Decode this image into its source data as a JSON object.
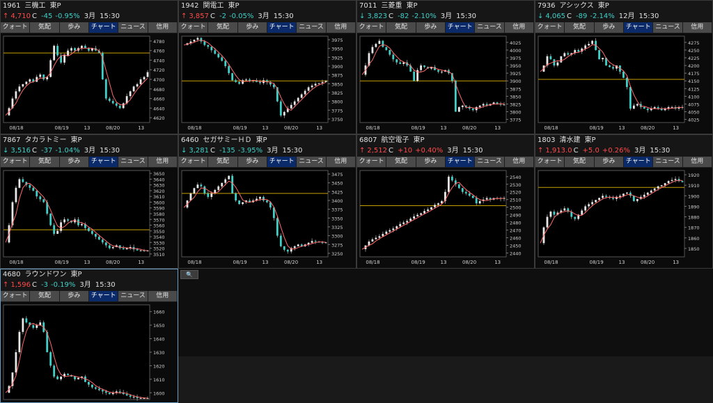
{
  "tabs": [
    "クォート",
    "気配",
    "歩み",
    "チャート",
    "ニュース",
    "信用"
  ],
  "active_tab": "チャート",
  "colors": {
    "up": "#ff4a4a",
    "down": "#3fd0c8",
    "candle_up": "#e8e8e8",
    "candle_down": "#3fd0c8",
    "ma": "#ff6b6b",
    "ref": "#c8a000",
    "axis": "#cfcfcf"
  },
  "search_icon": "magnifier-icon",
  "panels": [
    {
      "code": "1961",
      "name": "三機工",
      "market": "東P",
      "direction": "up",
      "price": "4,710",
      "unit": "C",
      "change": "-45",
      "pct": "-0.95%",
      "month": "3月",
      "time": "15:30",
      "x_labels": [
        "08/18",
        "08/19",
        "13",
        "08/20",
        "13"
      ],
      "y_labels": [
        "4780",
        "4760",
        "4740",
        "4720",
        "4700",
        "4680",
        "4660",
        "4640",
        "4620"
      ],
      "y_range": [
        4610,
        4790
      ],
      "ref": 4755,
      "chart_data": {
        "type": "candlestick",
        "series": [
          {
            "values": [
              4625,
              4640,
              4660,
              4675,
              4685,
              4690,
              4695,
              4700,
              4695,
              4705,
              4710,
              4700,
              4705,
              4740,
              4770,
              4750,
              4735,
              4750,
              4760,
              4765,
              4760,
              4765,
              4770,
              4765,
              4760,
              4765,
              4760,
              4755,
              4700,
              4660,
              4655,
              4650,
              4645,
              4640,
              4650,
              4665,
              4675,
              4685,
              4690,
              4700,
              4705,
              4715
            ]
          }
        ]
      }
    },
    {
      "code": "1942",
      "name": "関電工",
      "market": "東P",
      "direction": "up",
      "price": "3,857",
      "unit": "C",
      "change": "-2",
      "pct": "-0.05%",
      "month": "3月",
      "time": "15:30",
      "x_labels": [
        "08/18",
        "08/19",
        "13",
        "08/20",
        "13"
      ],
      "y_labels": [
        "3975",
        "3950",
        "3925",
        "3900",
        "3875",
        "3850",
        "3825",
        "3800",
        "3775",
        "3750"
      ],
      "y_range": [
        3740,
        3985
      ],
      "ref": 3858,
      "chart_data": {
        "type": "candlestick",
        "series": [
          {
            "values": [
              3960,
              3965,
              3970,
              3975,
              3980,
              3970,
              3960,
              3955,
              3945,
              3935,
              3925,
              3915,
              3900,
              3880,
              3860,
              3855,
              3850,
              3860,
              3862,
              3858,
              3860,
              3855,
              3852,
              3860,
              3855,
              3848,
              3840,
              3800,
              3760,
              3770,
              3780,
              3790,
              3800,
              3810,
              3820,
              3830,
              3840,
              3845,
              3850,
              3852,
              3855,
              3858
            ]
          }
        ]
      }
    },
    {
      "code": "7011",
      "name": "三菱重",
      "market": "東P",
      "direction": "down",
      "price": "3,823",
      "unit": "C",
      "change": "-82",
      "pct": "-2.10%",
      "month": "3月",
      "time": "15:30",
      "x_labels": [
        "08/18",
        "08/19",
        "13",
        "08/20",
        "13"
      ],
      "y_labels": [
        "4025",
        "4000",
        "3975",
        "3950",
        "3925",
        "3900",
        "3875",
        "3850",
        "3825",
        "3800",
        "3775"
      ],
      "y_range": [
        3765,
        4045
      ],
      "ref": 3900,
      "chart_data": {
        "type": "candlestick",
        "series": [
          {
            "values": [
              3920,
              3950,
              3990,
              4010,
              4020,
              4030,
              4010,
              4000,
              3985,
              3970,
              3960,
              3955,
              3960,
              3950,
              3930,
              3900,
              3935,
              3950,
              3945,
              3940,
              3945,
              3935,
              3930,
              3930,
              3935,
              3925,
              3900,
              3800,
              3815,
              3820,
              3815,
              3810,
              3805,
              3815,
              3820,
              3825,
              3820,
              3825,
              3830,
              3825,
              3823,
              3823
            ]
          }
        ]
      }
    },
    {
      "code": "7936",
      "name": "アシックス",
      "market": "東P",
      "direction": "down",
      "price": "4,065",
      "unit": "C",
      "change": "-89",
      "pct": "-2.14%",
      "month": "12月",
      "time": "15:30",
      "x_labels": [
        "08/18",
        "08/19",
        "13",
        "08/20",
        "13"
      ],
      "y_labels": [
        "4275",
        "4250",
        "4225",
        "4200",
        "4175",
        "4150",
        "4125",
        "4100",
        "4075",
        "4050",
        "4025"
      ],
      "y_range": [
        4015,
        4295
      ],
      "ref": 4155,
      "chart_data": {
        "type": "candlestick",
        "series": [
          {
            "values": [
              4180,
              4200,
              4230,
              4220,
              4200,
              4210,
              4230,
              4240,
              4235,
              4240,
              4250,
              4245,
              4255,
              4265,
              4270,
              4280,
              4250,
              4220,
              4225,
              4200,
              4195,
              4190,
              4200,
              4180,
              4160,
              4130,
              4060,
              4070,
              4075,
              4065,
              4060,
              4055,
              4060,
              4065,
              4060,
              4055,
              4060,
              4065,
              4065,
              4060,
              4065,
              4065
            ]
          }
        ]
      }
    },
    {
      "code": "7867",
      "name": "タカラトミー",
      "market": "東P",
      "direction": "down",
      "price": "3,516",
      "unit": "C",
      "change": "-37",
      "pct": "-1.04%",
      "month": "3月",
      "time": "15:30",
      "x_labels": [
        "08/18",
        "08/19",
        "13",
        "08/20",
        "13"
      ],
      "y_labels": [
        "3650",
        "3640",
        "3630",
        "3620",
        "3610",
        "3600",
        "3590",
        "3580",
        "3570",
        "3560",
        "3550",
        "3540",
        "3530",
        "3520",
        "3510"
      ],
      "y_range": [
        3505,
        3655
      ],
      "ref": 3552,
      "chart_data": {
        "type": "candlestick",
        "series": [
          {
            "values": [
              3530,
              3560,
              3600,
              3625,
              3640,
              3635,
              3630,
              3625,
              3620,
              3610,
              3605,
              3600,
              3580,
              3560,
              3545,
              3550,
              3565,
              3570,
              3568,
              3565,
              3570,
              3560,
              3562,
              3555,
              3550,
              3545,
              3540,
              3535,
              3530,
              3525,
              3520,
              3522,
              3525,
              3520,
              3518,
              3520,
              3522,
              3518,
              3516,
              3516,
              3515,
              3516
            ]
          }
        ]
      }
    },
    {
      "code": "6460",
      "name": "セガサミーＨＤ",
      "market": "東P",
      "direction": "down",
      "price": "3,281",
      "unit": "C",
      "change": "-135",
      "pct": "-3.95%",
      "month": "3月",
      "time": "15:30",
      "x_labels": [
        "08/18",
        "08/19",
        "13",
        "08/20",
        "13"
      ],
      "y_labels": [
        "3475",
        "3450",
        "3425",
        "3400",
        "3375",
        "3350",
        "3325",
        "3300",
        "3275",
        "3250"
      ],
      "y_range": [
        3240,
        3485
      ],
      "ref": 3420,
      "chart_data": {
        "type": "candlestick",
        "series": [
          {
            "values": [
              3380,
              3400,
              3420,
              3435,
              3445,
              3440,
              3420,
              3410,
              3420,
              3430,
              3440,
              3450,
              3460,
              3470,
              3420,
              3400,
              3390,
              3395,
              3400,
              3395,
              3400,
              3405,
              3410,
              3400,
              3395,
              3380,
              3350,
              3300,
              3270,
              3260,
              3255,
              3265,
              3270,
              3275,
              3270,
              3275,
              3280,
              3285,
              3283,
              3281,
              3280,
              3281
            ]
          }
        ]
      }
    },
    {
      "code": "6807",
      "name": "航空電子",
      "market": "東P",
      "direction": "up",
      "price": "2,512",
      "unit": "C",
      "change": "+10",
      "pct": "+0.40%",
      "month": "3月",
      "time": "15:30",
      "x_labels": [
        "08/18",
        "08/19",
        "13",
        "08/20",
        "13"
      ],
      "y_labels": [
        "2540",
        "2530",
        "2520",
        "2510",
        "2500",
        "2490",
        "2480",
        "2470",
        "2460",
        "2450",
        "2440"
      ],
      "y_range": [
        2435,
        2548
      ],
      "ref": 2502,
      "chart_data": {
        "type": "candlestick",
        "series": [
          {
            "values": [
              2445,
              2450,
              2455,
              2458,
              2460,
              2462,
              2465,
              2468,
              2470,
              2472,
              2475,
              2478,
              2480,
              2482,
              2485,
              2488,
              2490,
              2492,
              2495,
              2497,
              2500,
              2503,
              2505,
              2508,
              2520,
              2540,
              2535,
              2530,
              2525,
              2520,
              2518,
              2515,
              2512,
              2505,
              2508,
              2510,
              2512,
              2510,
              2512,
              2512,
              2511,
              2512
            ]
          }
        ]
      }
    },
    {
      "code": "1803",
      "name": "清水建",
      "market": "東P",
      "direction": "up",
      "price": "1,913.0",
      "unit": "C",
      "change": "+5.0",
      "pct": "+0.26%",
      "month": "3月",
      "time": "15:30",
      "x_labels": [
        "08/18",
        "08/19",
        "13",
        "08/20",
        "13"
      ],
      "y_labels": [
        "1920",
        "1910",
        "1900",
        "1890",
        "1880",
        "1870",
        "1860",
        "1850"
      ],
      "y_range": [
        1842,
        1924
      ],
      "ref": 1908,
      "chart_data": {
        "type": "candlestick",
        "series": [
          {
            "values": [
              1855,
              1870,
              1880,
              1885,
              1882,
              1884,
              1886,
              1888,
              1885,
              1880,
              1878,
              1882,
              1886,
              1890,
              1892,
              1894,
              1896,
              1898,
              1900,
              1899,
              1898,
              1897,
              1899,
              1900,
              1902,
              1903,
              1900,
              1895,
              1897,
              1899,
              1901,
              1903,
              1905,
              1907,
              1909,
              1910,
              1912,
              1914,
              1915,
              1916,
              1914,
              1913
            ]
          }
        ]
      }
    },
    {
      "code": "4680",
      "name": "ラウンドワン",
      "market": "東P",
      "direction": "up",
      "price": "1,596",
      "unit": "C",
      "change": "-3",
      "pct": "-0.19%",
      "month": "3月",
      "time": "15:30",
      "x_labels": [],
      "y_labels": [
        "1660",
        "1650",
        "1640",
        "1630",
        "1620",
        "1610",
        "1600"
      ],
      "y_range": [
        1595,
        1665
      ],
      "ref": null,
      "chart_data": {
        "type": "candlestick",
        "series": [
          {
            "values": [
              1600,
              1605,
              1615,
              1630,
              1645,
              1655,
              1652,
              1650,
              1648,
              1650,
              1652,
              1645,
              1630,
              1620,
              1612,
              1610,
              1612,
              1614,
              1613,
              1612,
              1610,
              1611,
              1612,
              1608,
              1606,
              1604,
              1603,
              1602,
              1601,
              1600,
              1599,
              1600,
              1601,
              1600,
              1599,
              1598,
              1597,
              1597,
              1596,
              1596,
              1596,
              1596
            ]
          }
        ]
      }
    }
  ]
}
